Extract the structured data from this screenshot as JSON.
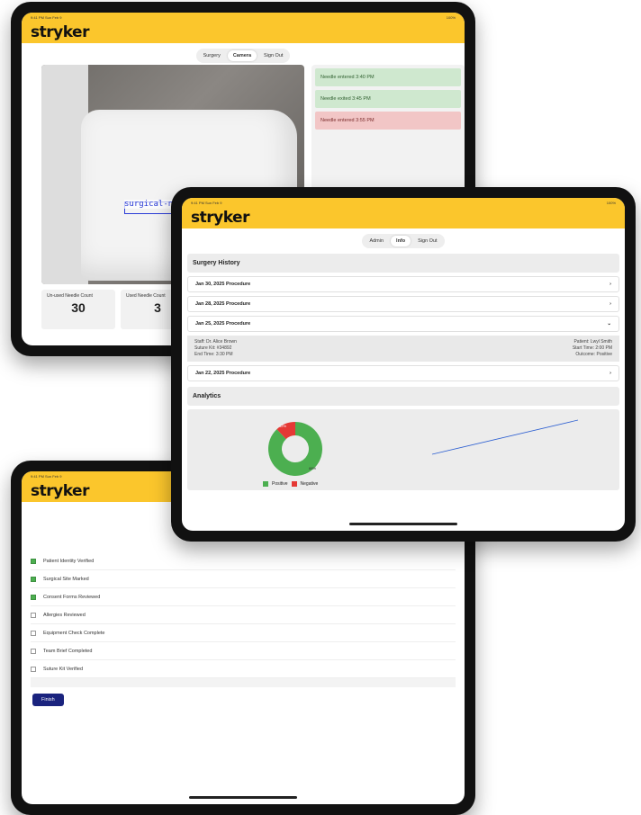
{
  "brand": {
    "logo": "stryker",
    "accent": "#fbc62c"
  },
  "device1": {
    "status_left": "9:41 PM  Sun Feb 9",
    "status_right": "100%",
    "tabs": [
      {
        "label": "Surgery"
      },
      {
        "label": "Camera",
        "active": true
      },
      {
        "label": "Sign Out"
      }
    ],
    "detection_label": "surgical-needle",
    "log": [
      {
        "text": "Needle entered 3:40 PM",
        "status": "ok"
      },
      {
        "text": "Needle exited 3:45 PM",
        "status": "ok"
      },
      {
        "text": "Needle entered 3:55 PM",
        "status": "bad"
      }
    ],
    "counts": [
      {
        "label": "Un-used Needle Count",
        "value": "30"
      },
      {
        "label": "Used Needle Count",
        "value": "3"
      }
    ]
  },
  "device2": {
    "status_left": "9:41 PM  Sun Feb 9",
    "status_right": "100%",
    "tabs": [
      {
        "label": "Admin"
      },
      {
        "label": "Info",
        "active": true
      },
      {
        "label": "Sign Out"
      }
    ],
    "history_title": "Surgery History",
    "procedures": [
      {
        "label": "Jan 30, 2025 Procedure"
      },
      {
        "label": "Jan 28, 2025 Procedure"
      },
      {
        "label": "Jan 25, 2025 Procedure",
        "expanded": true
      },
      {
        "label": "Jan 22, 2025 Procedure"
      }
    ],
    "detail": {
      "left": [
        "Staff: Dr. Alice Brown",
        "Suture Kit: #34892",
        "End Time: 3:30 PM"
      ],
      "right": [
        "Patient: Lwyl Smith",
        "Start Time: 2:00 PM",
        "Outcome: Positive"
      ]
    },
    "analytics_title": "Analytics",
    "legend": [
      {
        "label": "Positive",
        "color": "#4caf50"
      },
      {
        "label": "Negative",
        "color": "#e53935"
      }
    ],
    "donut": {
      "positive": 0.88,
      "negative": 0.12
    },
    "donut_labels": {
      "positive": "88%",
      "negative": "12%"
    }
  },
  "device3": {
    "status_left": "9:41 PM  Sun Feb 9",
    "checklist": [
      {
        "label": "Patient Identity Verified",
        "checked": true
      },
      {
        "label": "Surgical Site Marked",
        "checked": true
      },
      {
        "label": "Consent Forms Reviewed",
        "checked": true
      },
      {
        "label": "Allergies Reviewed",
        "checked": false
      },
      {
        "label": "Equipment Check Complete",
        "checked": false
      },
      {
        "label": "Team Brief Completed",
        "checked": false
      },
      {
        "label": "Suture Kit Verified",
        "checked": false
      }
    ],
    "back_label": "Finish"
  }
}
